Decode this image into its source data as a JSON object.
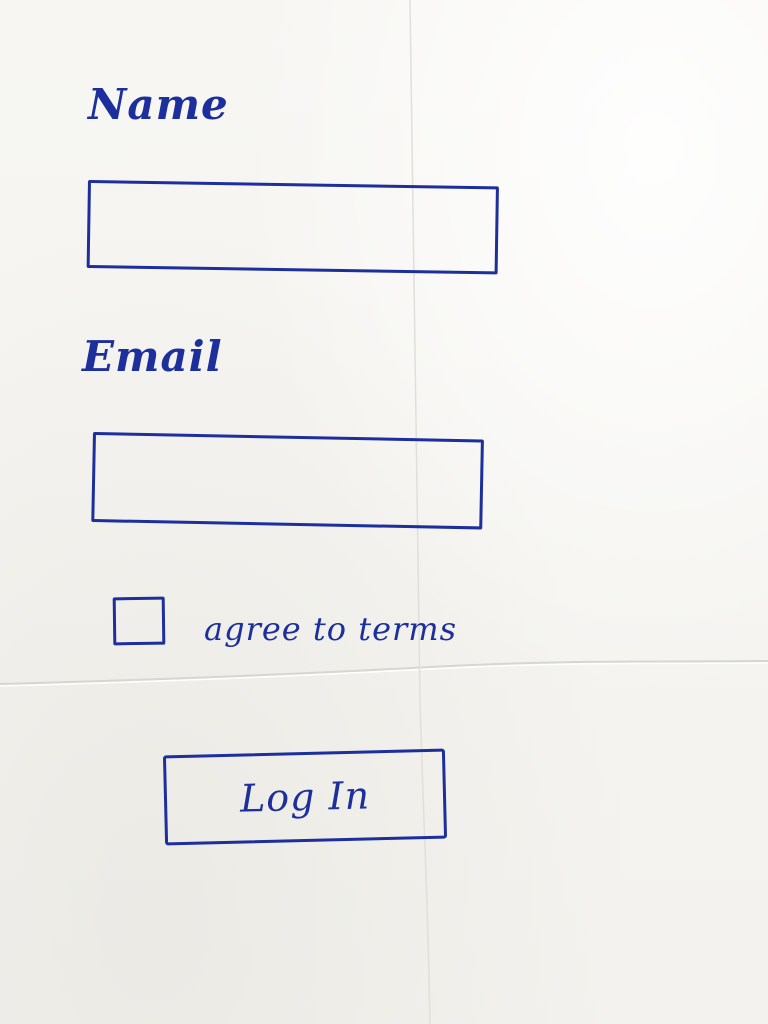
{
  "form": {
    "name_label": "Name",
    "name_value": "",
    "email_label": "Email",
    "email_value": "",
    "terms_label": "agree to terms",
    "terms_checked": false,
    "login_label": "Log In"
  },
  "colors": {
    "ink": "#1c2f9c",
    "paper": "#f6f5f2"
  }
}
